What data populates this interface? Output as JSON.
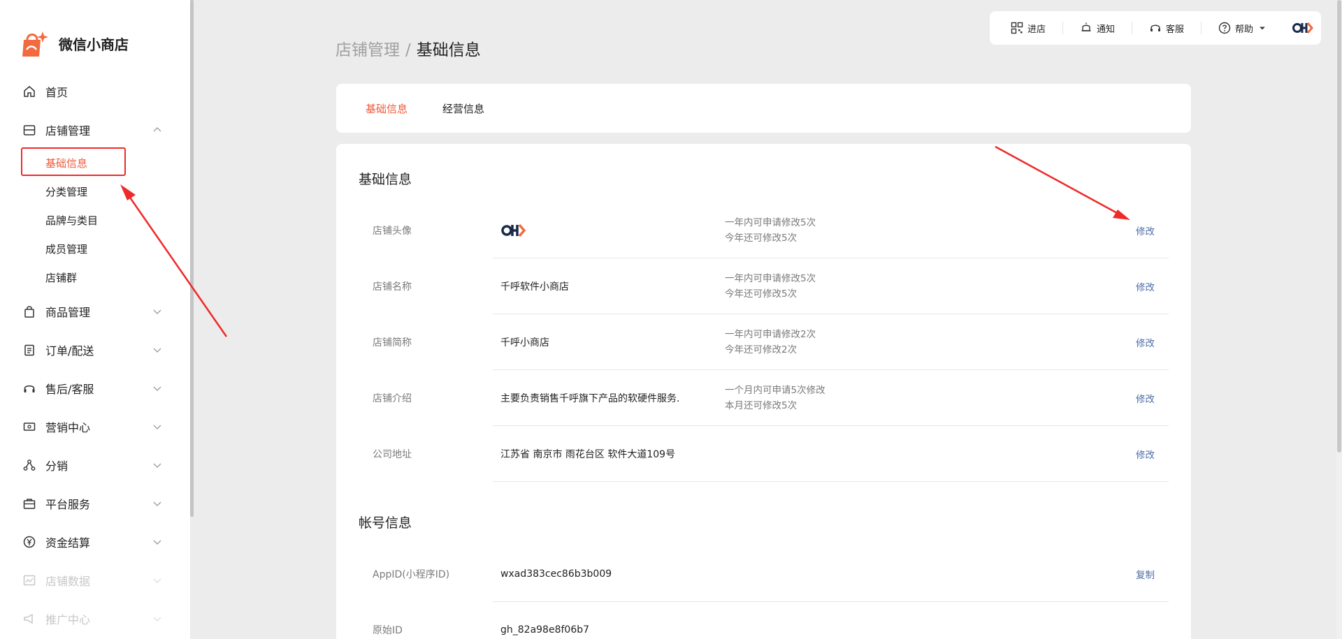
{
  "app": {
    "name": "微信小商店"
  },
  "sidebar": {
    "items": [
      {
        "label": "首页",
        "icon": "home-icon"
      },
      {
        "label": "店铺管理",
        "icon": "store-icon",
        "expanded": true,
        "children": [
          "基础信息",
          "分类管理",
          "品牌与类目",
          "成员管理",
          "店铺群"
        ]
      },
      {
        "label": "商品管理",
        "icon": "bag-icon"
      },
      {
        "label": "订单/配送",
        "icon": "clipboard-icon"
      },
      {
        "label": "售后/客服",
        "icon": "headset-icon"
      },
      {
        "label": "营销中心",
        "icon": "ticket-icon"
      },
      {
        "label": "分销",
        "icon": "share-icon"
      },
      {
        "label": "平台服务",
        "icon": "briefcase-icon"
      },
      {
        "label": "资金结算",
        "icon": "yen-icon"
      },
      {
        "label": "店铺数据",
        "icon": "chart-icon"
      },
      {
        "label": "推广中心",
        "icon": "megaphone-icon"
      }
    ],
    "active_child": "基础信息"
  },
  "toolbar": {
    "enter_store": "进店",
    "notify": "通知",
    "service": "客服",
    "help": "帮助"
  },
  "page": {
    "crumb": "店铺管理",
    "separator": "/",
    "title": "基础信息"
  },
  "tabs": [
    {
      "label": "基础信息",
      "active": true
    },
    {
      "label": "经营信息",
      "active": false
    }
  ],
  "basic": {
    "section_title": "基础信息",
    "rows": [
      {
        "label": "店铺头像",
        "value": "",
        "hint1": "一年内可申请修改5次",
        "hint2": "今年还可修改5次",
        "action": "修改"
      },
      {
        "label": "店铺名称",
        "value": "千呼软件小商店",
        "hint1": "一年内可申请修改5次",
        "hint2": "今年还可修改5次",
        "action": "修改"
      },
      {
        "label": "店铺简称",
        "value": "千呼小商店",
        "hint1": "一年内可申请修改2次",
        "hint2": "今年还可修改2次",
        "action": "修改"
      },
      {
        "label": "店铺介绍",
        "value": "主要负责销售千呼旗下产品的软硬件服务.",
        "hint1": "一个月内可申请5次修改",
        "hint2": "本月还可修改5次",
        "action": "修改"
      },
      {
        "label": "公司地址",
        "value": "江苏省 南京市 雨花台区 软件大道109号",
        "hint1": "",
        "hint2": "",
        "action": "修改"
      }
    ]
  },
  "account": {
    "section_title": "帐号信息",
    "rows": [
      {
        "label": "AppID(小程序ID)",
        "value": "wxad383cec86b3b009",
        "action": "复制"
      },
      {
        "label": "原始ID",
        "value": "gh_82a98e8f06b7",
        "action": ""
      }
    ]
  },
  "colors": {
    "accent": "#f05a3c",
    "link": "#4f6fa8",
    "annotation": "#ee2a2a"
  }
}
